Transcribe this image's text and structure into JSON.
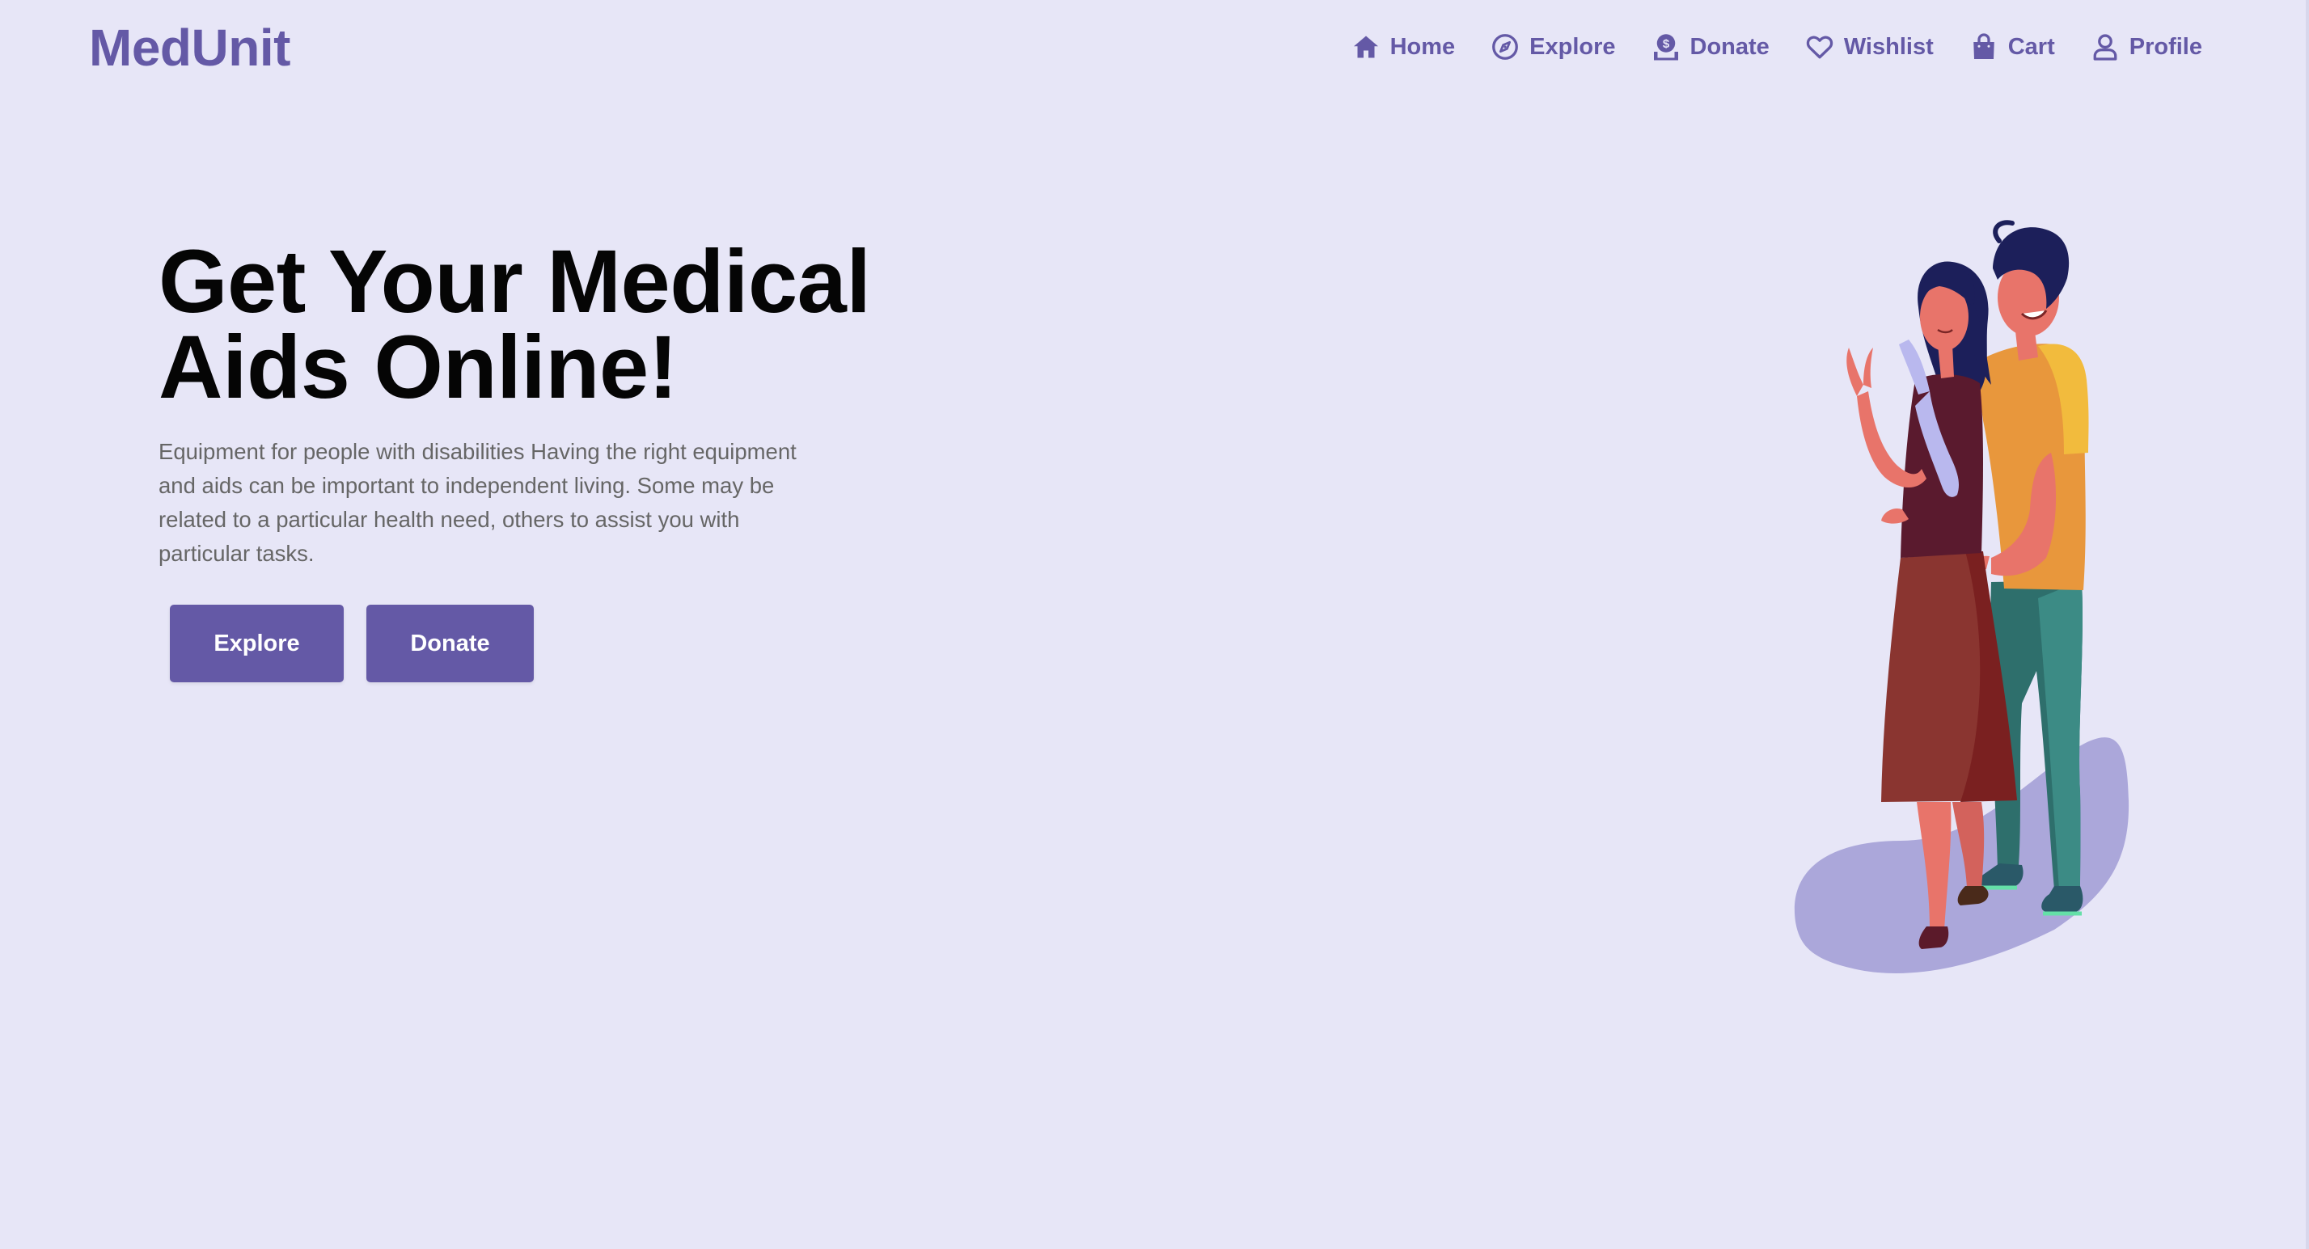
{
  "brand": {
    "name": "MedUnit",
    "color": "#6459a6",
    "background": "#e7e6f7"
  },
  "nav": {
    "items": [
      {
        "label": "Home",
        "icon": "home-icon"
      },
      {
        "label": "Explore",
        "icon": "compass-icon"
      },
      {
        "label": "Donate",
        "icon": "donate-icon"
      },
      {
        "label": "Wishlist",
        "icon": "heart-icon"
      },
      {
        "label": "Cart",
        "icon": "shopping-bag-icon"
      },
      {
        "label": "Profile",
        "icon": "user-icon"
      }
    ]
  },
  "hero": {
    "title_line1": "Get Your Medical",
    "title_line2": "Aids Online!",
    "description": "Equipment for people with disabilities Having the right equipment and aids can be important to independent living. Some may be related to a particular health need, others to assist you with particular tasks.",
    "buttons": {
      "explore": "Explore",
      "donate": "Donate"
    },
    "illustration": "couple-heart-gesture-illustration"
  }
}
